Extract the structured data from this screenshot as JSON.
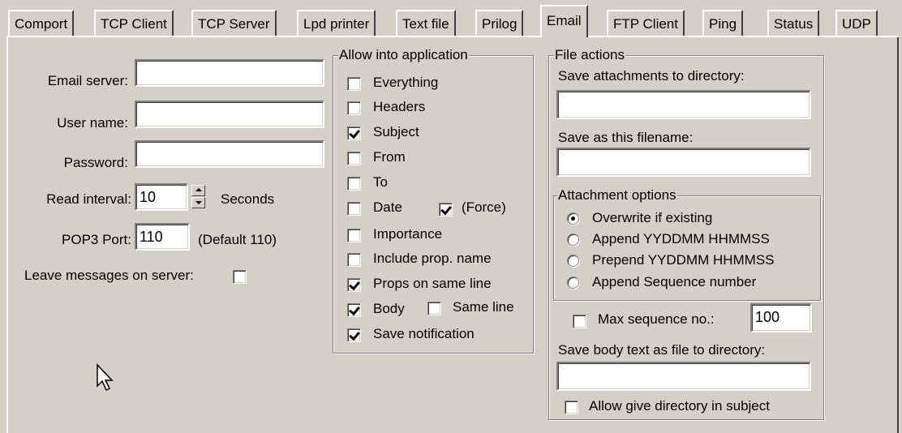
{
  "tabs": [
    {
      "label": "Comport"
    },
    {
      "label": "TCP Client"
    },
    {
      "label": "TCP Server"
    },
    {
      "label": "Lpd printer"
    },
    {
      "label": "Text file"
    },
    {
      "label": "Prilog"
    },
    {
      "label": "Email",
      "active": true
    },
    {
      "label": "FTP Client"
    },
    {
      "label": "Ping"
    },
    {
      "label": "Status"
    },
    {
      "label": "UDP"
    }
  ],
  "server": {
    "email_server_label": "Email server:",
    "email_server_value": "",
    "user_name_label": "User name:",
    "user_name_value": "",
    "password_label": "Password:",
    "password_value": "",
    "read_interval_label": "Read interval:",
    "read_interval_value": "10",
    "seconds_label": "Seconds",
    "pop3_port_label": "POP3 Port:",
    "pop3_port_value": "110",
    "pop3_default_label": "(Default 110)",
    "leave_messages_label": "Leave messages on server:",
    "leave_messages_checked": false
  },
  "allow": {
    "title": "Allow into application",
    "items": [
      {
        "label": "Everything",
        "checked": false
      },
      {
        "label": "Headers",
        "checked": false
      },
      {
        "label": "Subject",
        "checked": true
      },
      {
        "label": "From",
        "checked": false
      },
      {
        "label": "To",
        "checked": false
      },
      {
        "label": "Date",
        "checked": false
      },
      {
        "label": "Importance",
        "checked": false
      },
      {
        "label": "Include prop. name",
        "checked": false
      },
      {
        "label": "Props on same line",
        "checked": true
      },
      {
        "label": "Body",
        "checked": true
      },
      {
        "label": "Save notification",
        "checked": true
      }
    ],
    "force_label": "(Force)",
    "force_checked": true,
    "same_line_label": "Same line",
    "same_line_checked": false
  },
  "file_actions": {
    "title": "File actions",
    "save_attachments_label": "Save attachments to directory:",
    "save_attachments_value": "",
    "save_filename_label": "Save as this filename:",
    "save_filename_value": "",
    "attachment_options_title": "Attachment options",
    "options": [
      {
        "label": "Overwrite if existing",
        "selected": true
      },
      {
        "label": "Append YYDDMM HHMMSS",
        "selected": false
      },
      {
        "label": "Prepend YYDDMM HHMMSS",
        "selected": false
      },
      {
        "label": "Append Sequence number",
        "selected": false
      }
    ],
    "max_sequence_label": "Max sequence no.:",
    "max_sequence_checked": false,
    "max_sequence_value": "100",
    "save_body_label": "Save body text as file to directory:",
    "save_body_value": "",
    "allow_dir_label": "Allow give directory in subject",
    "allow_dir_checked": false
  }
}
